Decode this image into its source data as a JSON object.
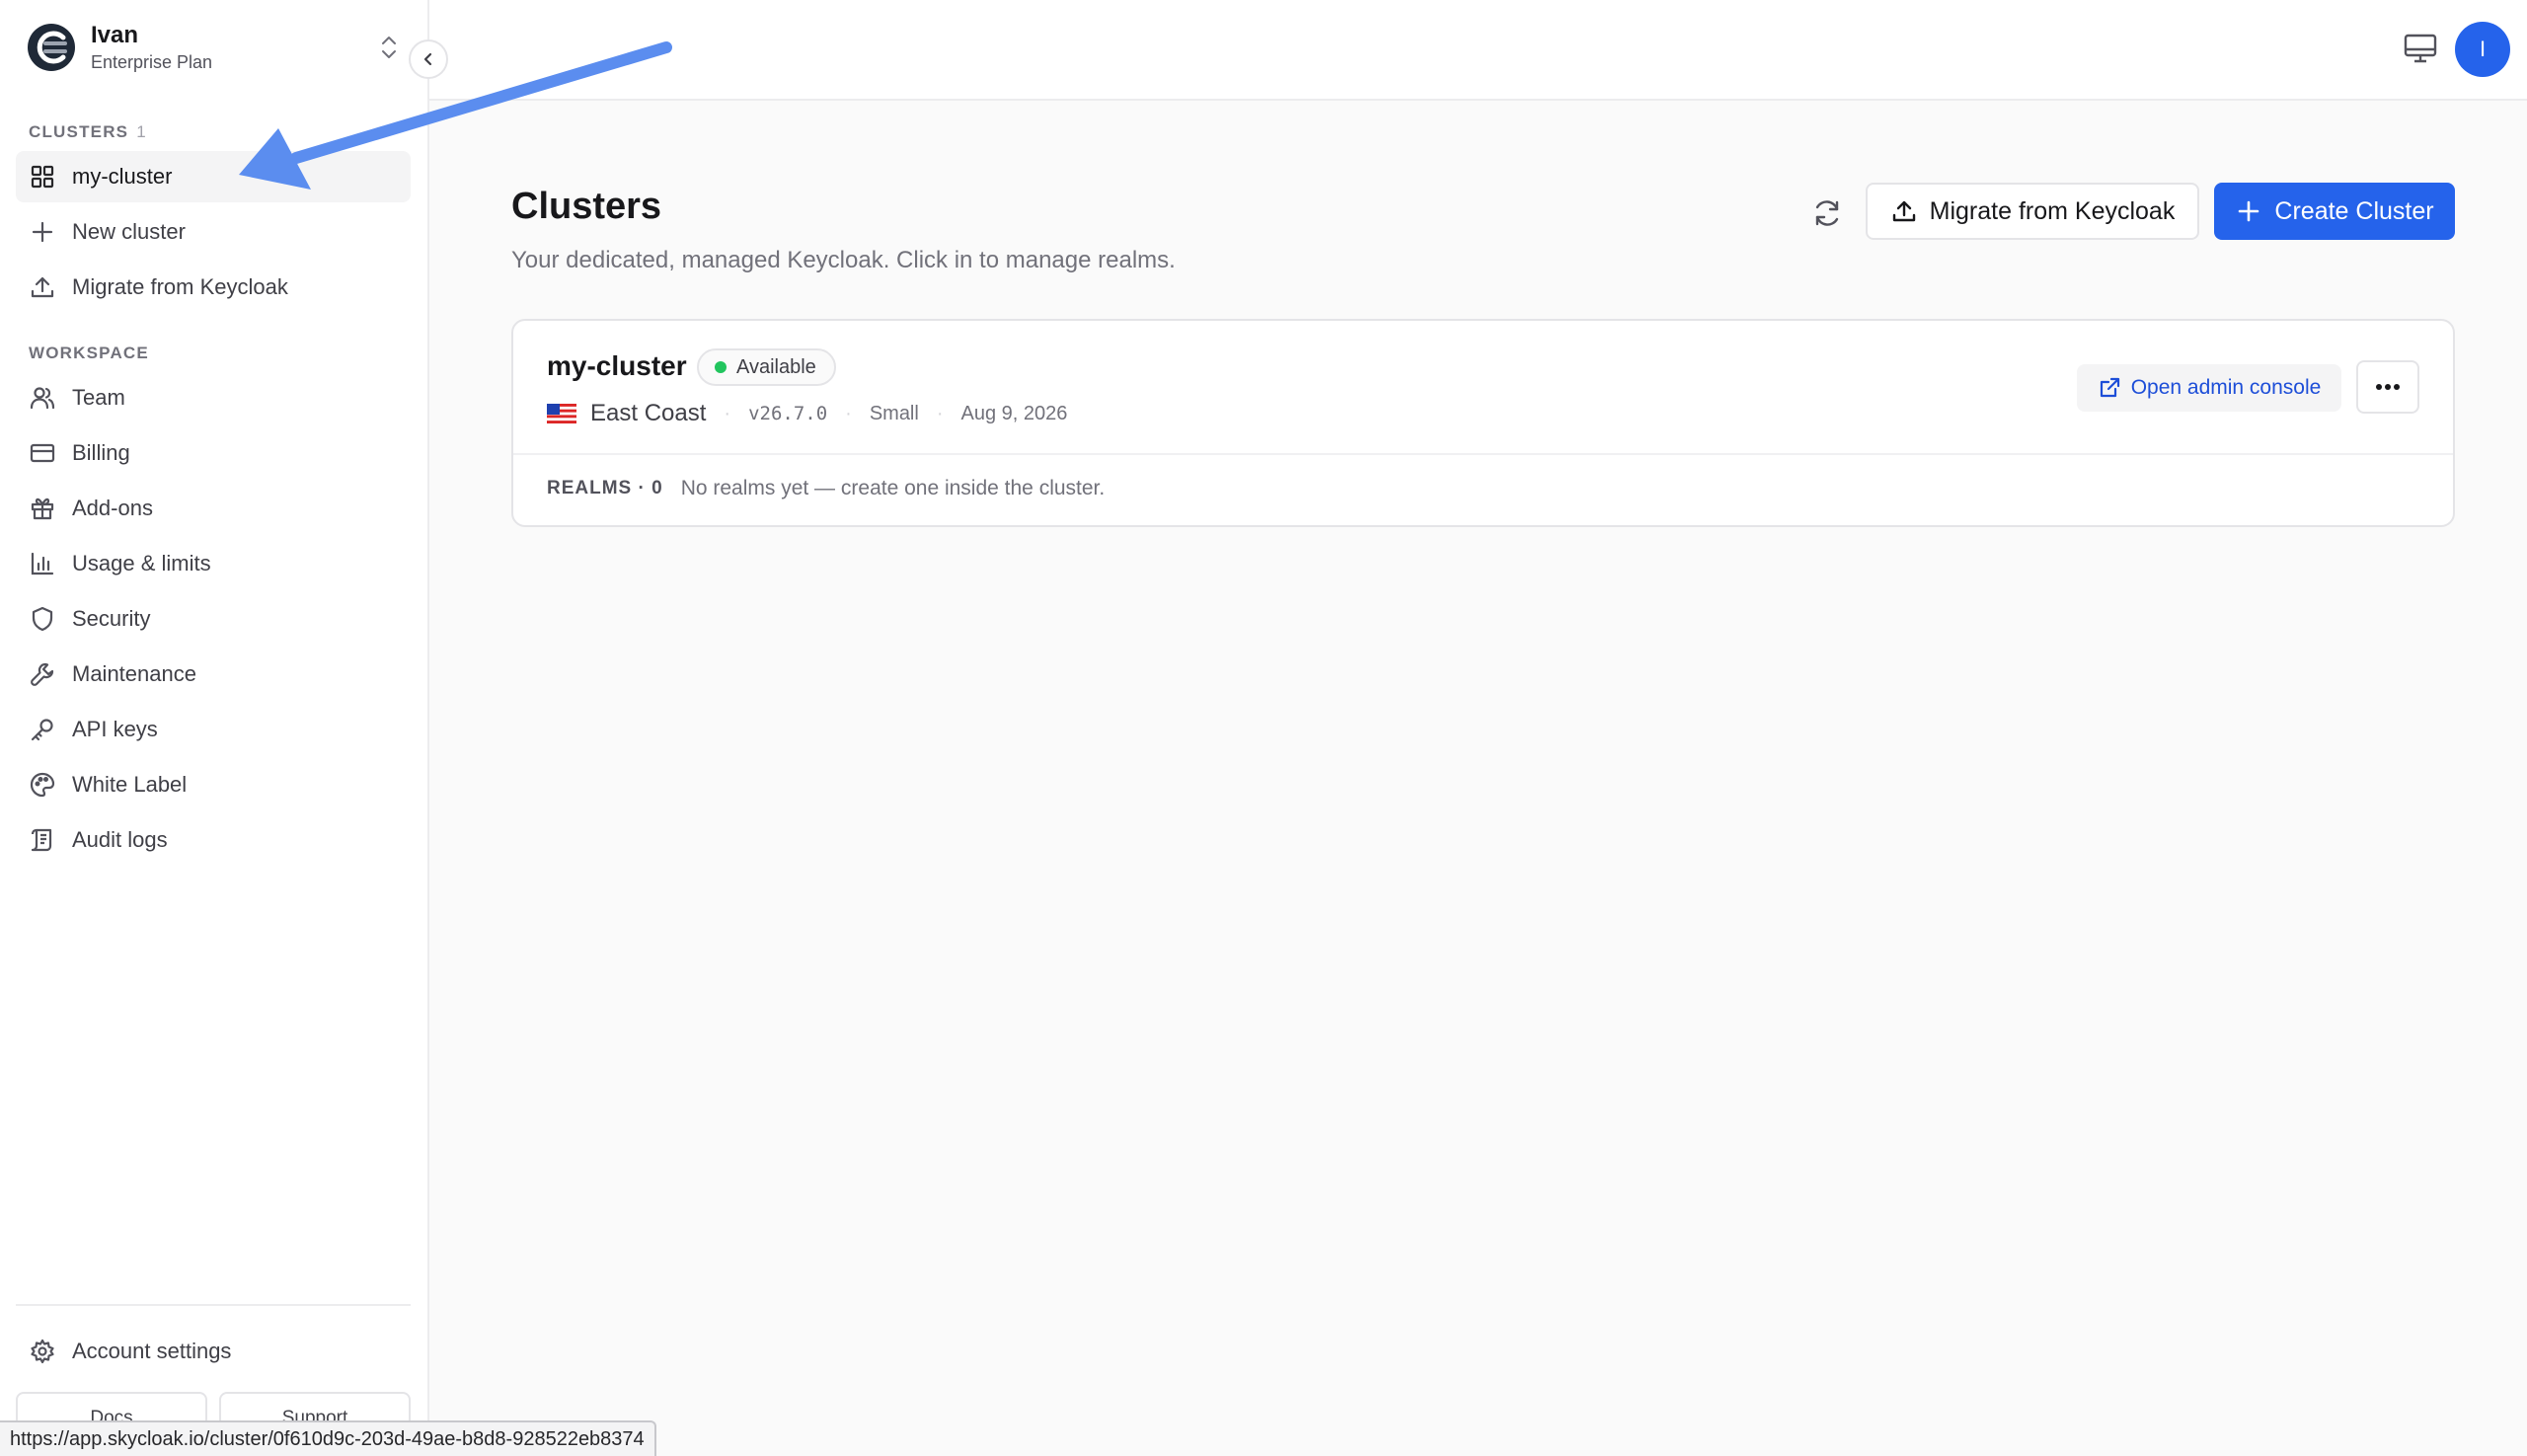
{
  "org": {
    "name": "Ivan",
    "plan": "Enterprise Plan"
  },
  "sidebar": {
    "clusters_label": "CLUSTERS",
    "clusters_count": "1",
    "cluster_items": [
      {
        "label": "my-cluster",
        "icon": "grid-icon"
      },
      {
        "label": "New cluster",
        "icon": "plus-icon"
      },
      {
        "label": "Migrate from Keycloak",
        "icon": "upload-icon"
      }
    ],
    "workspace_label": "WORKSPACE",
    "workspace_items": [
      {
        "label": "Team",
        "icon": "users-icon"
      },
      {
        "label": "Billing",
        "icon": "credit-card-icon"
      },
      {
        "label": "Add-ons",
        "icon": "gift-icon"
      },
      {
        "label": "Usage & limits",
        "icon": "bar-chart-icon"
      },
      {
        "label": "Security",
        "icon": "shield-icon"
      },
      {
        "label": "Maintenance",
        "icon": "wrench-icon"
      },
      {
        "label": "API keys",
        "icon": "key-icon"
      },
      {
        "label": "White Label",
        "icon": "palette-icon"
      },
      {
        "label": "Audit logs",
        "icon": "scroll-icon"
      }
    ],
    "account_settings": "Account settings",
    "docs": "Docs",
    "support": "Support"
  },
  "topbar": {
    "avatar_initial": "I"
  },
  "main": {
    "title": "Clusters",
    "subtitle": "Your dedicated, managed Keycloak. Click in to manage realms.",
    "migrate_label": "Migrate from Keycloak",
    "create_label": "Create Cluster"
  },
  "cluster": {
    "name": "my-cluster",
    "status": "Available",
    "region": "East Coast",
    "version": "v26.7.0",
    "size": "Small",
    "date": "Aug 9, 2026",
    "open_admin": "Open admin console",
    "realms_label": "REALMS · 0",
    "realms_msg": "No realms yet — create one inside the cluster."
  },
  "status_url": "https://app.skycloak.io/cluster/0f610d9c-203d-49ae-b8d8-928522eb8374",
  "colors": {
    "accent": "#2563eb",
    "status_ok": "#22c55e",
    "annotation": "#5b8def"
  }
}
